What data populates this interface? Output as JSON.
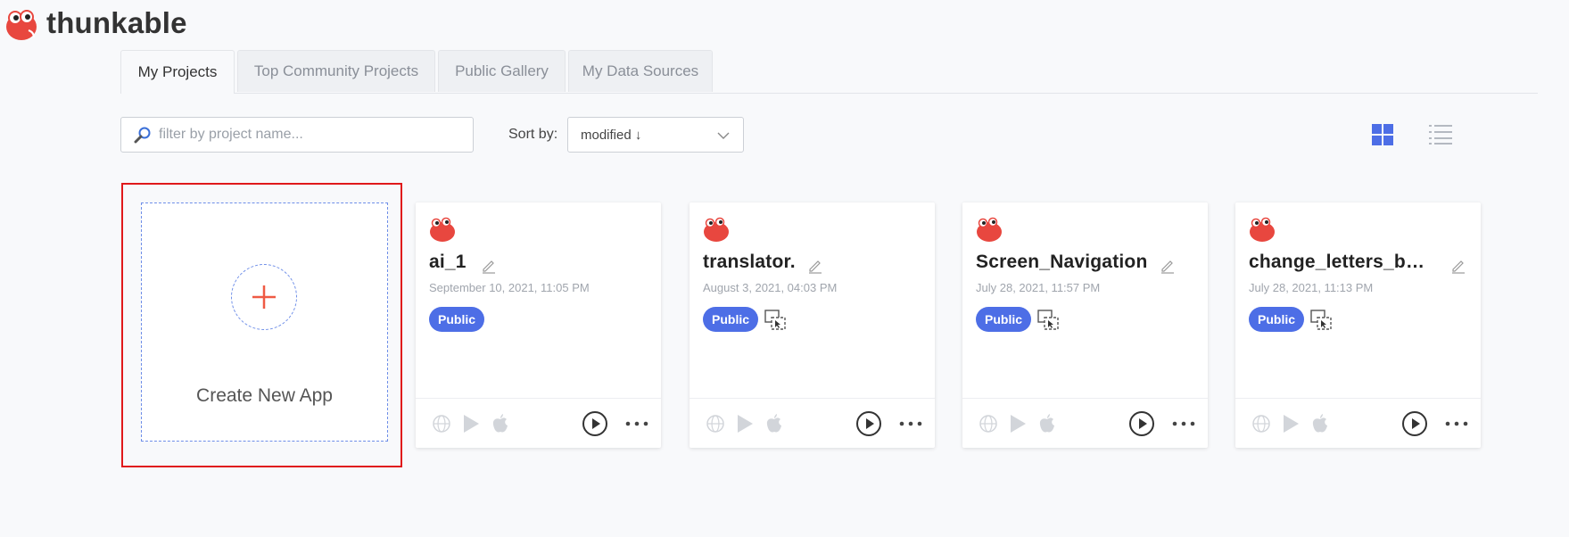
{
  "app": {
    "logo_text": "thunkable"
  },
  "tabs": [
    {
      "label": "My Projects",
      "active": true
    },
    {
      "label": "Top Community Projects",
      "active": false
    },
    {
      "label": "Public Gallery",
      "active": false
    },
    {
      "label": "My Data Sources",
      "active": false
    }
  ],
  "search": {
    "placeholder": "filter by project name..."
  },
  "sort": {
    "label": "Sort by:",
    "value": "modified ↓"
  },
  "create": {
    "label": "Create New App"
  },
  "projects": [
    {
      "name": "ai_1",
      "date": "September 10, 2021, 11:05 PM",
      "badge": "Public",
      "shared": false
    },
    {
      "name": "translator.",
      "date": "August 3, 2021, 04:03 PM",
      "badge": "Public",
      "shared": true
    },
    {
      "name": "Screen_Navigation",
      "date": "July 28, 2021, 11:57 PM",
      "badge": "Public",
      "shared": true
    },
    {
      "name": "change_letters_by_different_buttons",
      "date": "July 28, 2021, 11:13 PM",
      "badge": "Public",
      "shared": true
    }
  ],
  "colors": {
    "accent": "#4d6ee6",
    "mascot": "#e8473f",
    "highlight": "#e0191b"
  }
}
